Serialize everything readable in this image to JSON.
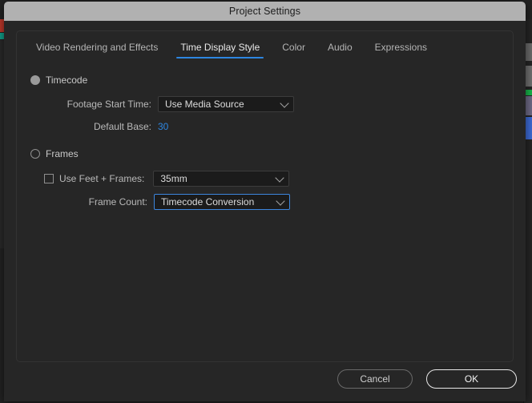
{
  "dialog": {
    "title": "Project Settings"
  },
  "tabs": [
    {
      "label": "Video Rendering and Effects",
      "active": false
    },
    {
      "label": "Time Display Style",
      "active": true
    },
    {
      "label": "Color",
      "active": false
    },
    {
      "label": "Audio",
      "active": false
    },
    {
      "label": "Expressions",
      "active": false
    }
  ],
  "form": {
    "timecode": {
      "radio_label": "Timecode",
      "selected": true,
      "footage_start_time": {
        "label": "Footage Start Time:",
        "value": "Use Media Source"
      },
      "default_base": {
        "label": "Default Base:",
        "value": "30"
      }
    },
    "frames": {
      "radio_label": "Frames",
      "selected": false,
      "use_feet_frames": {
        "label": "Use Feet + Frames:",
        "checked": false,
        "value": "35mm"
      },
      "frame_count": {
        "label": "Frame Count:",
        "value": "Timecode Conversion",
        "focused": true
      }
    }
  },
  "footer": {
    "cancel_label": "Cancel",
    "ok_label": "OK"
  },
  "colors": {
    "accent_blue": "#2d86e0",
    "titlebar": "#b1b1b1",
    "dialog_bg": "#262626",
    "field_bg": "#1b1b1b"
  }
}
